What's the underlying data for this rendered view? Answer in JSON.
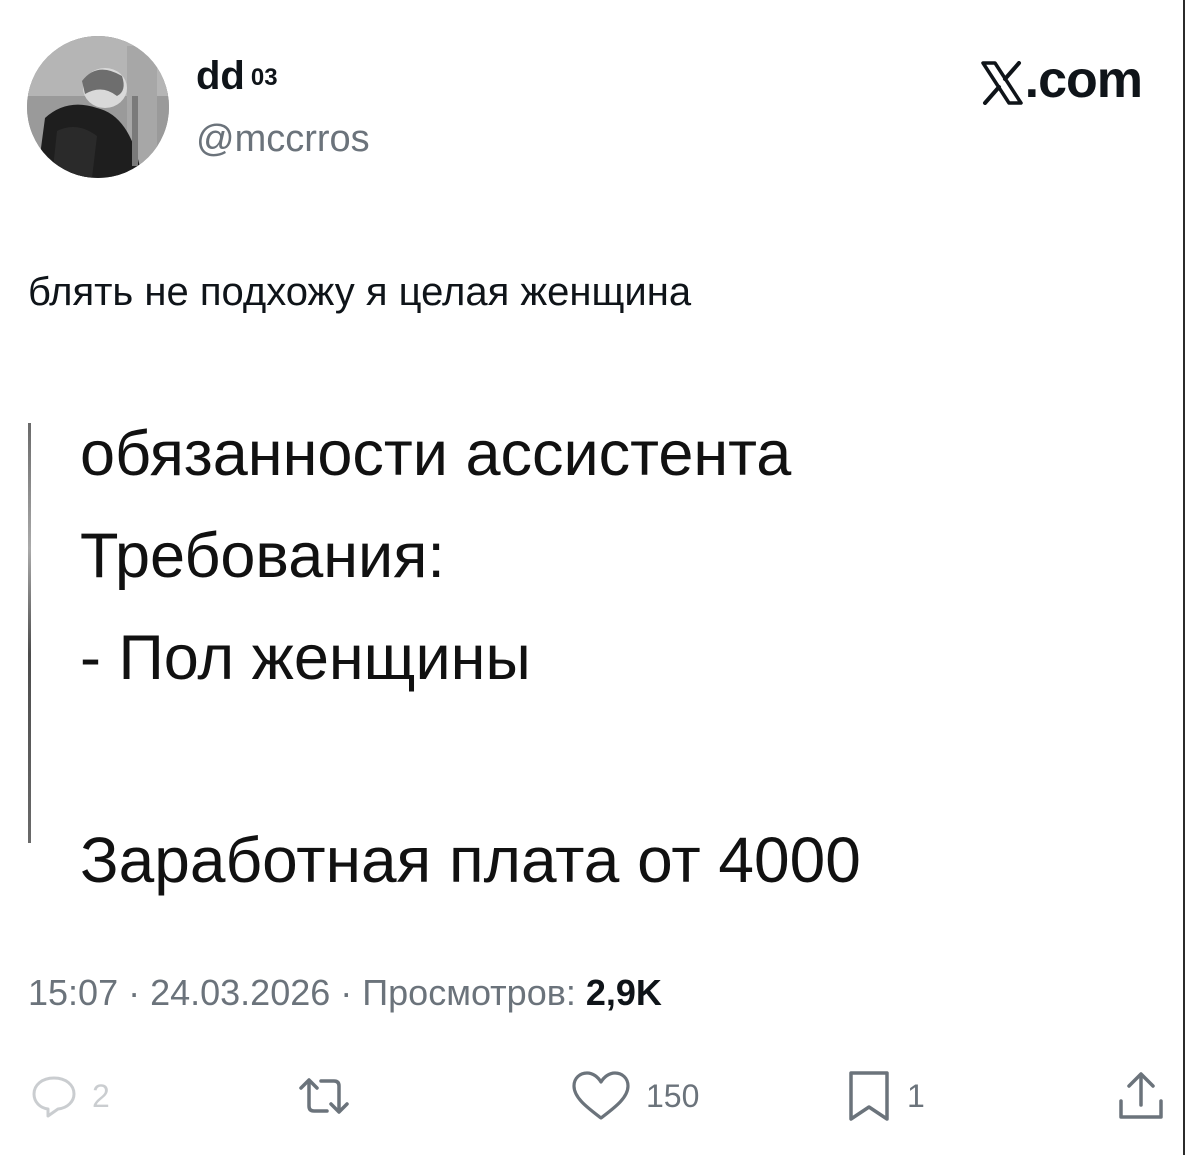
{
  "author": {
    "display_name": "dd",
    "display_name_sup": "03",
    "handle": "@mccrros"
  },
  "brand": {
    "label": ".com"
  },
  "tweet": {
    "text": "блять не подхожу я целая женщина"
  },
  "embed": {
    "lines": [
      "обязанности ассистента",
      "Требования:",
      "- Пол женщины",
      "Заработная плата от 4000"
    ]
  },
  "meta": {
    "time": "15:07",
    "separator": " · ",
    "date": "24.03.2026",
    "views_label": "Просмотров:",
    "views_count": "2,9K"
  },
  "actions": {
    "replies": {
      "icon": "reply-icon",
      "count": "2"
    },
    "reposts": {
      "icon": "repost-icon",
      "count": ""
    },
    "likes": {
      "icon": "heart-icon",
      "count": "150"
    },
    "bookmarks": {
      "icon": "bookmark-icon",
      "count": "1"
    },
    "share": {
      "icon": "share-icon"
    }
  },
  "colors": {
    "text": "#0f1419",
    "secondary": "#6b737b",
    "background": "#ffffff"
  }
}
